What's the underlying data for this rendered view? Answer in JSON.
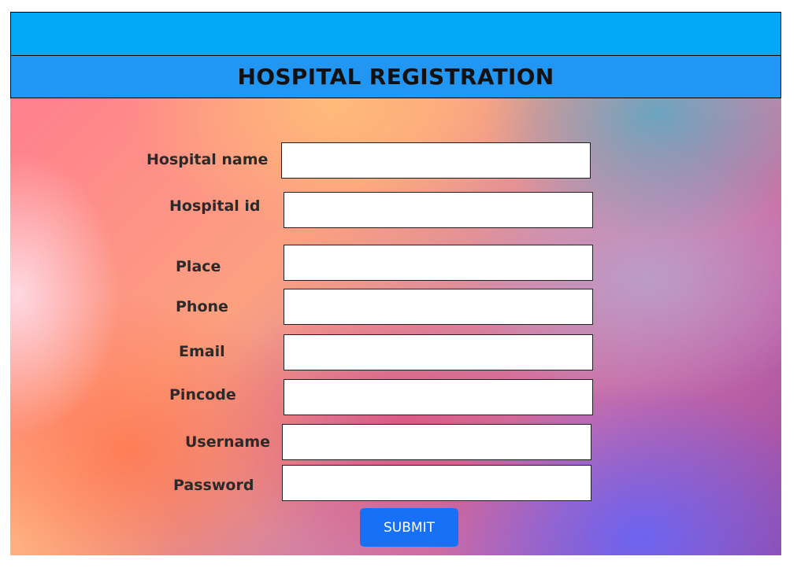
{
  "header": {
    "title": "HOSPITAL REGISTRATION"
  },
  "form": {
    "fields": [
      {
        "label": "Hospital name",
        "value": "",
        "placeholder": ""
      },
      {
        "label": "Hospital id",
        "value": "",
        "placeholder": ""
      },
      {
        "label": "Place",
        "value": "",
        "placeholder": ""
      },
      {
        "label": "Phone",
        "value": "",
        "placeholder": ""
      },
      {
        "label": "Email",
        "value": "",
        "placeholder": ""
      },
      {
        "label": "Pincode",
        "value": "",
        "placeholder": ""
      },
      {
        "label": "Username",
        "value": "",
        "placeholder": ""
      },
      {
        "label": "Password",
        "value": "",
        "placeholder": ""
      }
    ],
    "submit_label": "SUBMIT"
  },
  "colors": {
    "topbar": "#03a9f4",
    "titlebar": "#2196f3",
    "submit_button": "#1671f7"
  }
}
